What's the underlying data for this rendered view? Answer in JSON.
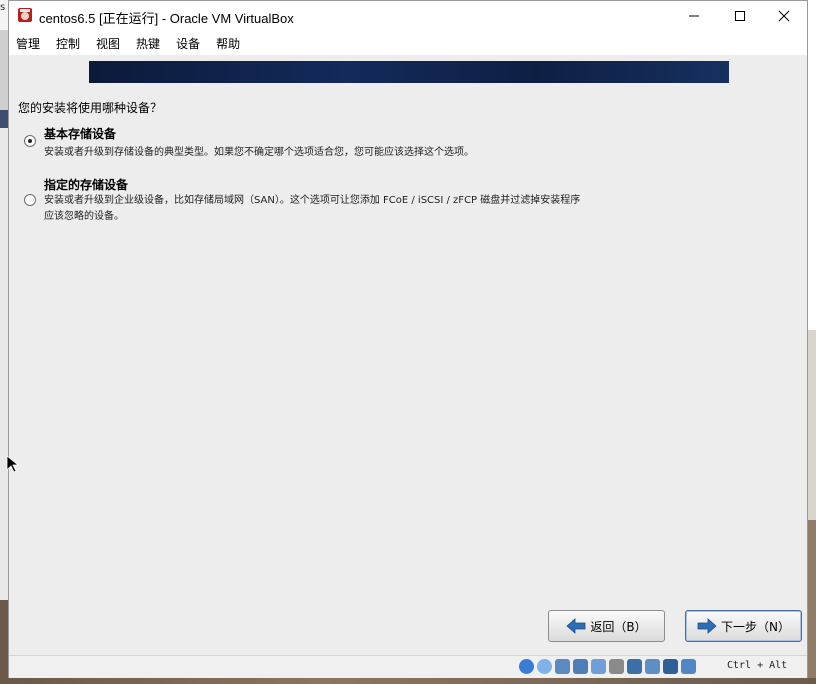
{
  "desktop": {
    "left_tab_char": "s"
  },
  "window": {
    "title": "centos6.5 [正在运行] - Oracle VM VirtualBox",
    "minimize_glyph": "─",
    "maximize_glyph": "☐",
    "close_glyph": "✕"
  },
  "menu": [
    "管理",
    "控制",
    "视图",
    "热键",
    "设备",
    "帮助"
  ],
  "installer": {
    "question": "您的安装将使用哪种设备？",
    "options": [
      {
        "title": "基本存储设备",
        "description": "安装或者升级到存储设备的典型类型。如果您不确定哪个选项适合您，您可能应该选择这个选项。",
        "selected": true
      },
      {
        "title": "指定的存储设备",
        "description_line1": "安装或者升级到企业级设备，比如存储局域网（SAN）。这个选项可让您添加 FCoE / iSCSI / zFCP 磁盘并过滤掉安装程序",
        "description_line2": "应该忽略的设备。",
        "selected": false
      }
    ],
    "back_label": "返回（B）",
    "next_label": "下一步（N）"
  },
  "status": {
    "icons": [
      "hdd-icon",
      "cd-icon",
      "usb-icon",
      "network-icon",
      "shared-folder-icon",
      "display-icon",
      "record-icon",
      "mouse-integration-icon",
      "cpu-icon",
      "keyboard-icon"
    ],
    "host_key": "Ctrl + Alt"
  },
  "colors": {
    "banner": "#0e1f44",
    "arrow_blue": "#2f6db5"
  }
}
